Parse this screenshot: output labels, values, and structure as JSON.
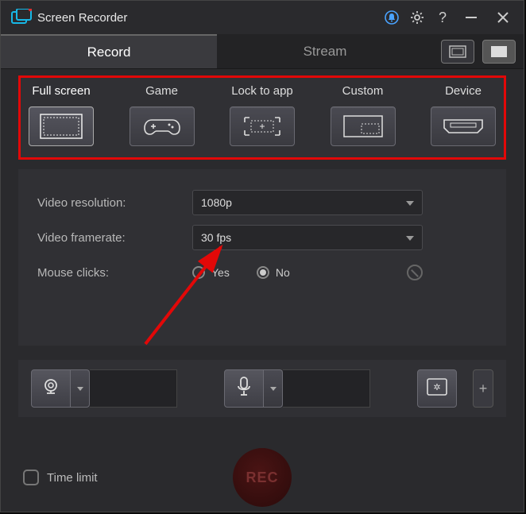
{
  "app": {
    "title": "Screen Recorder"
  },
  "titlebar": {
    "notification": "notification-bell-icon",
    "settings": "gear-icon",
    "help": "?",
    "minimize": "–",
    "close": "×"
  },
  "tabs": {
    "record": "Record",
    "stream": "Stream"
  },
  "modes": [
    {
      "label": "Full screen"
    },
    {
      "label": "Game"
    },
    {
      "label": "Lock to app"
    },
    {
      "label": "Custom"
    },
    {
      "label": "Device"
    }
  ],
  "settings": {
    "resolution_label": "Video resolution:",
    "resolution_value": "1080p",
    "framerate_label": "Video framerate:",
    "framerate_value": "30 fps",
    "mouseclicks_label": "Mouse clicks:",
    "mouseclicks_yes": "Yes",
    "mouseclicks_no": "No",
    "mouseclicks_selected": "No"
  },
  "footer": {
    "timelimit_label": "Time limit",
    "rec_label": "REC"
  },
  "colors": {
    "highlight": "#e20808"
  }
}
